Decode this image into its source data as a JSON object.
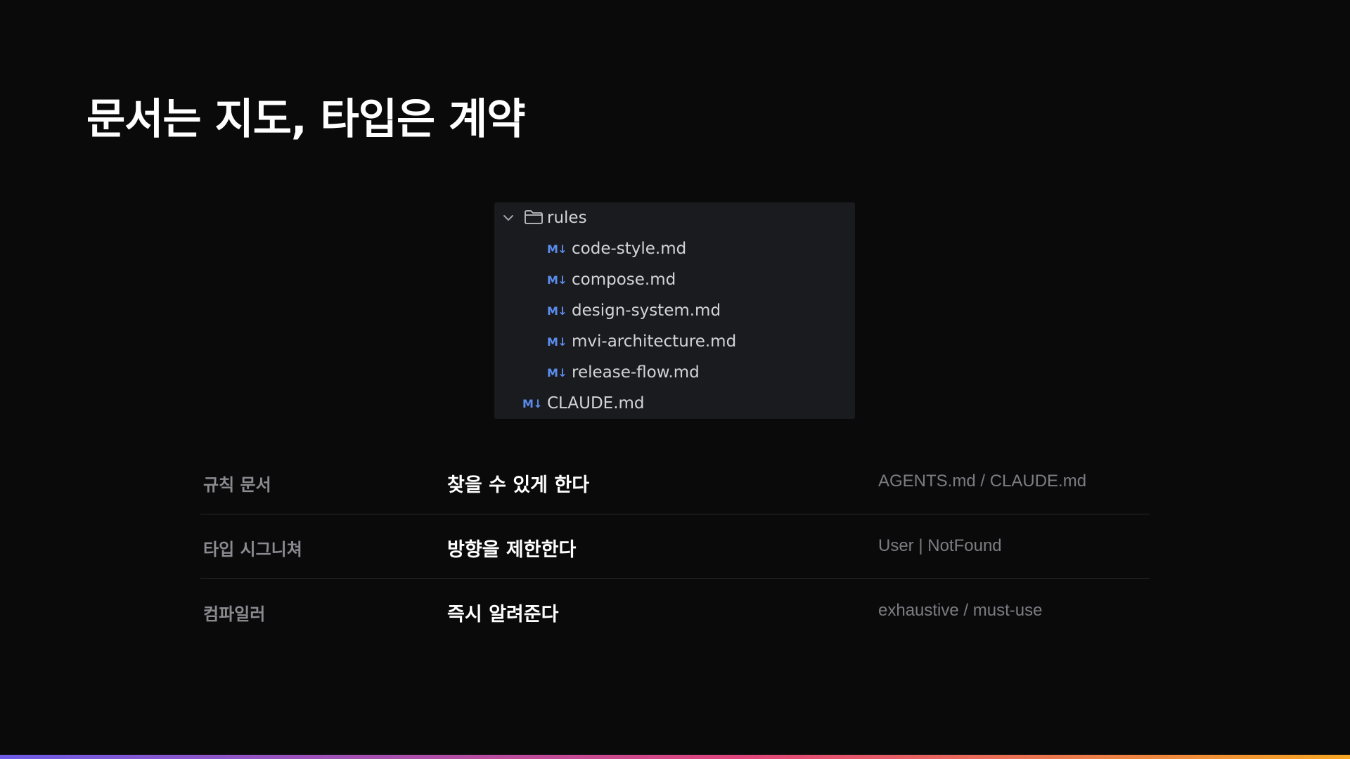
{
  "slide": {
    "title": "문서는 지도, 타입은 계약"
  },
  "explorer": {
    "folder": {
      "name": "rules",
      "icon": "folder-icon",
      "expand_icon": "chevron-down-icon",
      "expanded": true
    },
    "file_icon_text": "M↓",
    "children": [
      "code-style.md",
      "compose.md",
      "design-system.md",
      "mvi-architecture.md",
      "release-flow.md"
    ],
    "root_file": "CLAUDE.md"
  },
  "table": {
    "rows": [
      {
        "label": "규칙 문서",
        "desc": "찾을 수 있게 한다",
        "note": "AGENTS.md / CLAUDE.md"
      },
      {
        "label": "타입 시그니쳐",
        "desc": "방향을 제한한다",
        "note": "User | NotFound"
      },
      {
        "label": "컴파일러",
        "desc": "즉시 알려준다",
        "note": "exhaustive / must-use"
      }
    ]
  },
  "colors": {
    "background": "#0a0a0b",
    "panel": "#1a1b1e",
    "md_icon": "#5b8def",
    "gradient_start": "#6c5ce7",
    "gradient_mid": "#e0457b",
    "gradient_end": "#f5a623"
  }
}
